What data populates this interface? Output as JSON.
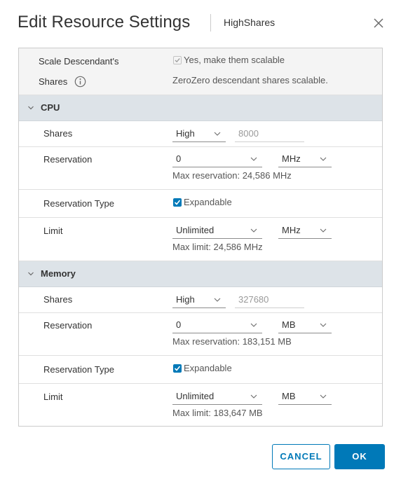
{
  "dialog": {
    "title": "Edit Resource Settings",
    "subtitle": "HighShares",
    "close_icon": "close-icon"
  },
  "scale": {
    "label_line1": "Scale Descendant's",
    "label_line2": "Shares",
    "checkbox_label": "Yes, make them scalable",
    "checked": true,
    "note": "ZeroZero descendant shares scalable."
  },
  "cpu": {
    "title": "CPU",
    "shares_label": "Shares",
    "shares_level": "High",
    "shares_value": "8000",
    "reservation_label": "Reservation",
    "reservation_value": "0",
    "reservation_unit": "MHz",
    "reservation_hint": "Max reservation: 24,586 MHz",
    "reservation_type_label": "Reservation Type",
    "expandable_label": "Expandable",
    "expandable_checked": true,
    "limit_label": "Limit",
    "limit_value": "Unlimited",
    "limit_unit": "MHz",
    "limit_hint": "Max limit: 24,586 MHz"
  },
  "memory": {
    "title": "Memory",
    "shares_label": "Shares",
    "shares_level": "High",
    "shares_value": "327680",
    "reservation_label": "Reservation",
    "reservation_value": "0",
    "reservation_unit": "MB",
    "reservation_hint": "Max reservation: 183,151 MB",
    "reservation_type_label": "Reservation Type",
    "expandable_label": "Expandable",
    "expandable_checked": true,
    "limit_label": "Limit",
    "limit_value": "Unlimited",
    "limit_unit": "MB",
    "limit_hint": "Max limit: 183,647 MB"
  },
  "buttons": {
    "cancel": "CANCEL",
    "ok": "OK"
  },
  "colors": {
    "accent": "#0079b8",
    "section_header": "#dde3e8"
  }
}
